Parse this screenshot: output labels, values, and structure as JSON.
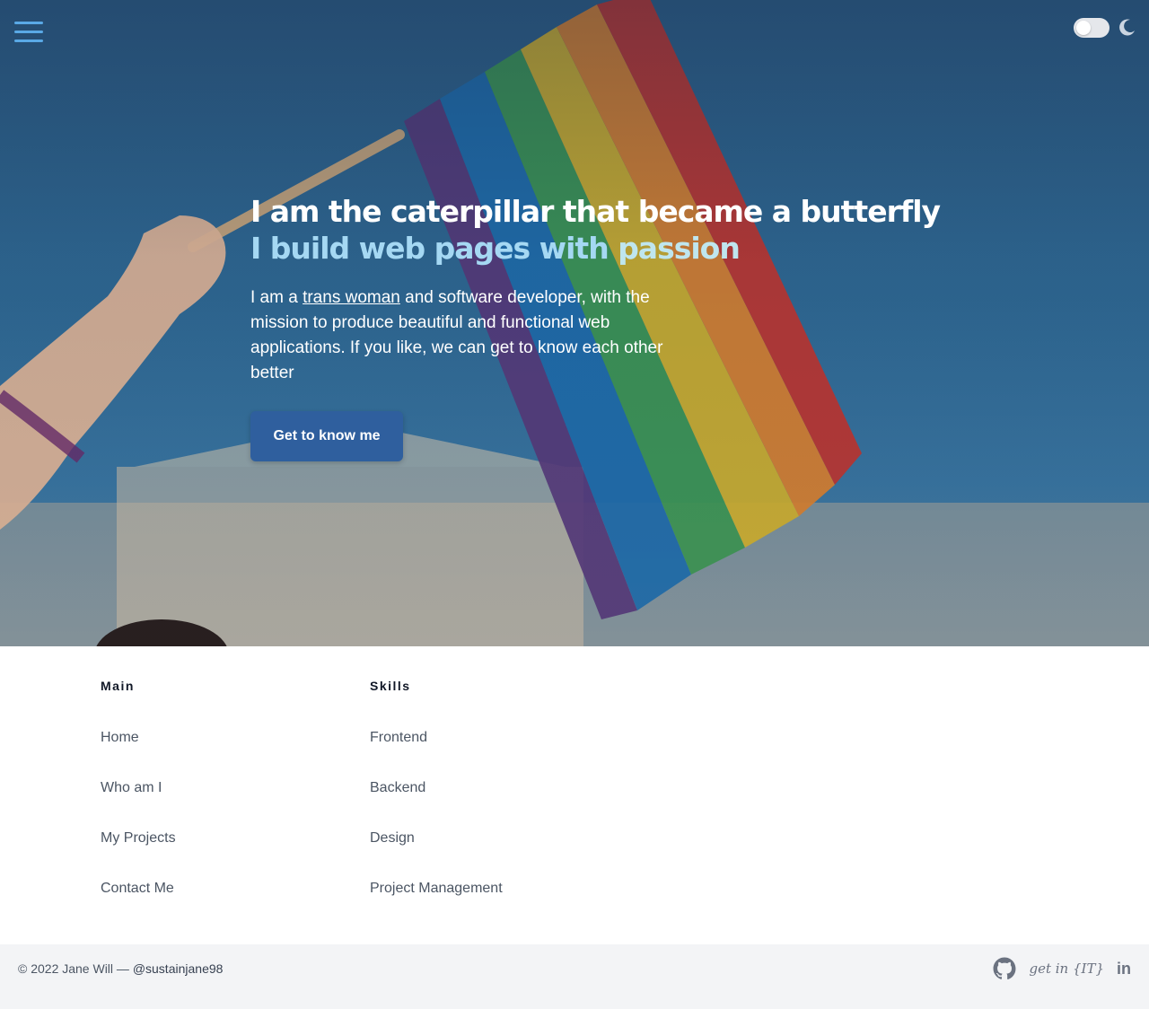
{
  "hero": {
    "title": "I am the caterpillar that became a butterfly",
    "subtitle_main": "I build web pages with ",
    "subtitle_accent": "passion",
    "description_before": "I am a ",
    "description_link": "trans woman",
    "description_after": " and software developer, with the mission to produce beautiful and functional web applications. If you like, we can get to know each other better",
    "cta_label": "Get to know me"
  },
  "header": {
    "menu_icon": "hamburger-menu-icon",
    "theme_toggle_icon": "moon-icon"
  },
  "footer": {
    "main": {
      "heading": "Main",
      "items": [
        "Home",
        "Who am I",
        "My Projects",
        "Contact Me"
      ]
    },
    "skills": {
      "heading": "Skills",
      "items": [
        "Frontend",
        "Backend",
        "Design",
        "Project Management"
      ]
    },
    "copyright": "© 2022 Jane Will — ",
    "handle": "@sustainjane98",
    "social": {
      "github_icon": "github-icon",
      "getin_label": "get in {IT}",
      "linkedin_label": "in"
    }
  },
  "colors": {
    "accent": "#a5d8f3",
    "button": "#2f5f9e",
    "menu": "#5aa9e6"
  }
}
